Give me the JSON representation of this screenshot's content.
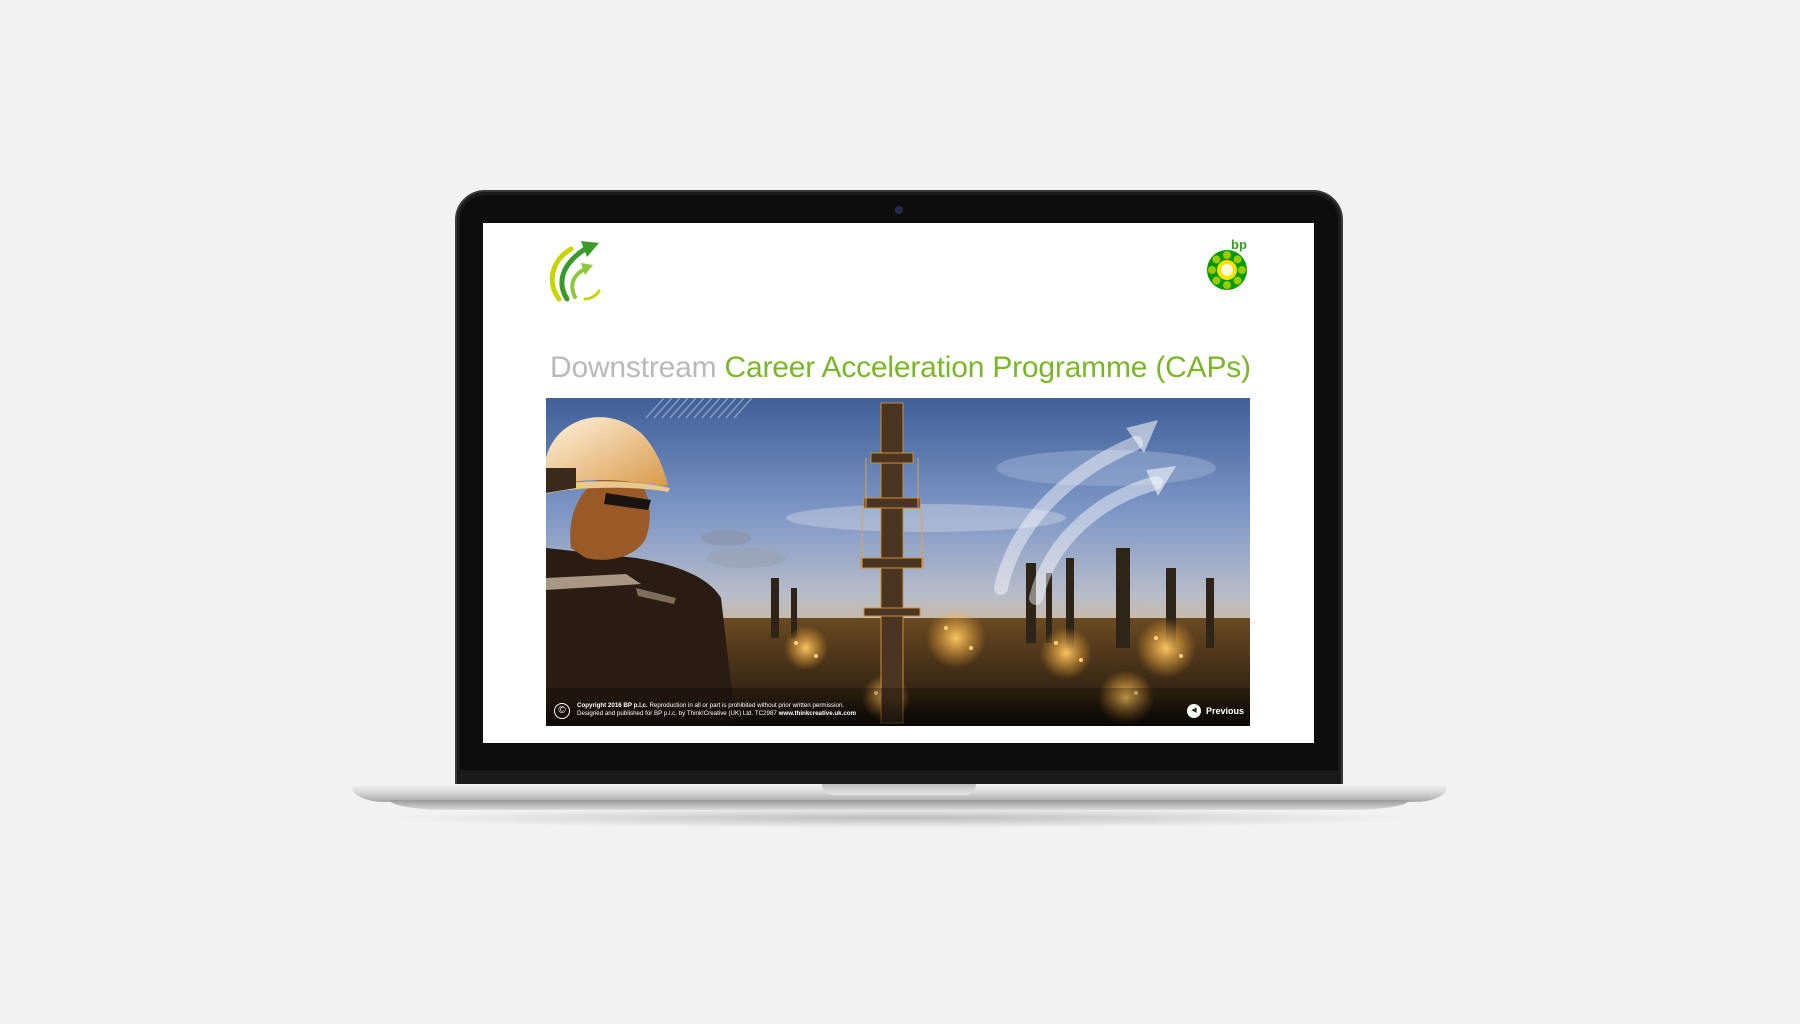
{
  "page": {
    "title_grey": "Downstream",
    "title_green": "Career Acceleration Programme (CAPs)"
  },
  "branding": {
    "bp_wordmark": "bp"
  },
  "footer": {
    "copyright_symbol": "©",
    "copyright_bold": "Copyright 2016 BP p.l.c.",
    "copyright_rest": "Reproduction in all or part is prohibited without prior written permission.",
    "designed_by": "Designed and published for BP p.l.c. by Think!Creative (UK) Ltd. TC2987",
    "website": "www.thinkcreative.uk.com",
    "previous_icon": "◀",
    "previous_label": "Previous"
  },
  "icons": {
    "caps_logo": "rising-arrows-icon",
    "bp_logo": "helios-sunflower-icon",
    "copyright": "copyright-icon",
    "previous": "left-arrow-circle-icon"
  },
  "colors": {
    "brand_green": "#7bb62a",
    "title_grey": "#b9b9b9",
    "bp_yellow": "#ffe100",
    "bp_green": "#009900"
  }
}
